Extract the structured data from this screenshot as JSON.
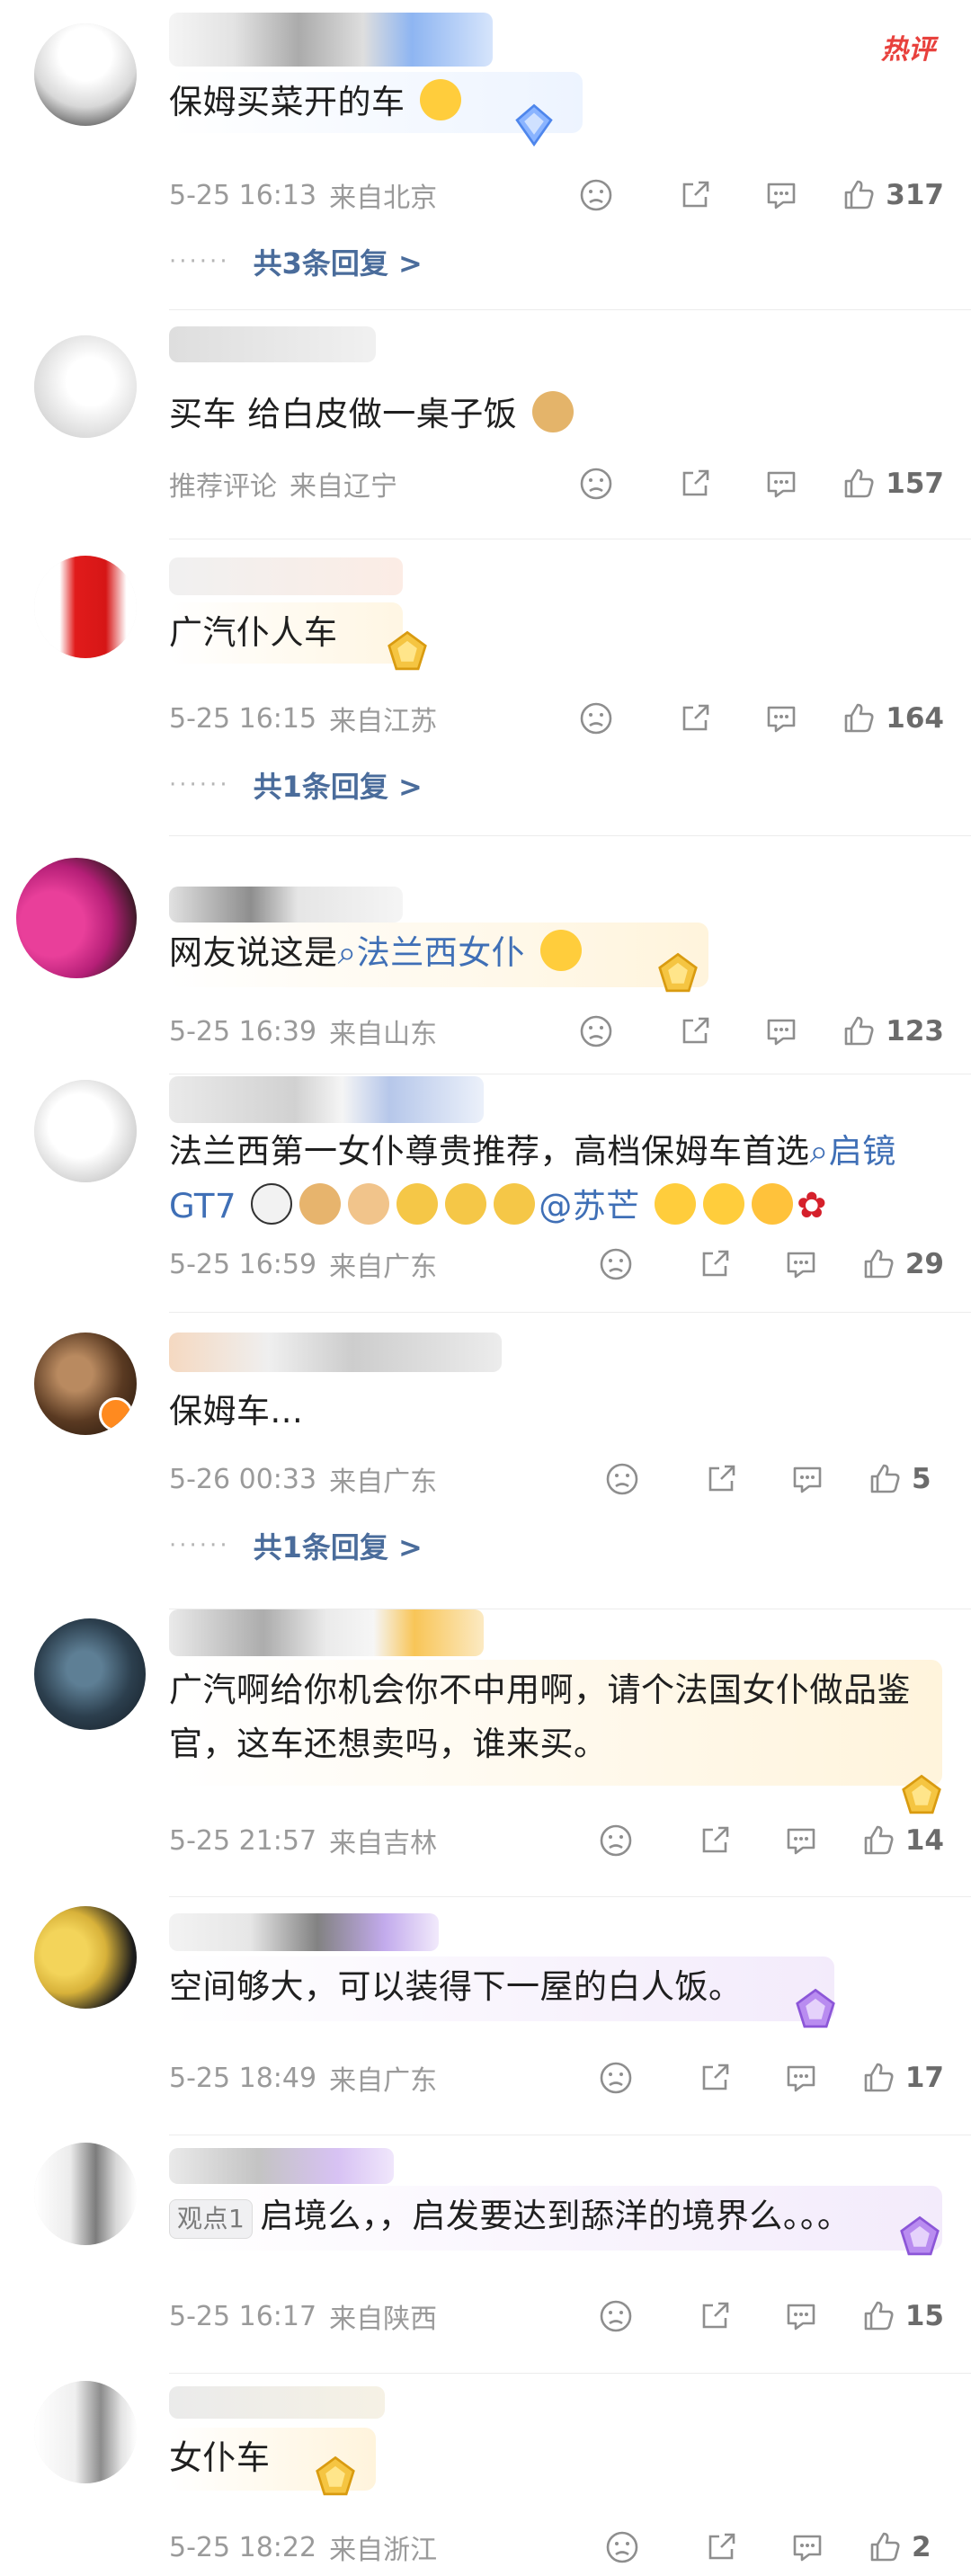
{
  "hot_label": "热评",
  "colors": {
    "link": "#3f6fb6",
    "meta": "#9a9a9a",
    "accent": "#e8413d"
  },
  "comments": [
    {
      "text": "保姆买菜开的车",
      "time": "5-25 16:13",
      "location": "来自北京",
      "likes": "317",
      "replies": "共3条回复 >"
    },
    {
      "text": "买车 给白皮做一桌子饭",
      "time": "推荐评论",
      "location": "来自辽宁",
      "likes": "157"
    },
    {
      "text": "广汽仆人车",
      "time": "5-25 16:15",
      "location": "来自江苏",
      "likes": "164",
      "replies": "共1条回复 >"
    },
    {
      "text_prefix": "网友说这是",
      "text_link": "法兰西女仆",
      "time": "5-25 16:39",
      "location": "来自山东",
      "likes": "123"
    },
    {
      "text": "法兰西第一女仆尊贵推荐，高档保姆车首选",
      "text_link": "启镜 GT7",
      "mention": "@苏芒",
      "time": "5-25 16:59",
      "location": "来自广东",
      "likes": "29"
    },
    {
      "text": "保姆车...",
      "time": "5-26 00:33",
      "location": "来自广东",
      "likes": "5",
      "replies": "共1条回复 >"
    },
    {
      "text": "广汽啊给你机会你不中用啊，请个法国女仆做品鉴官，这车还想卖吗，谁来买。",
      "time": "5-25 21:57",
      "location": "来自吉林",
      "likes": "14"
    },
    {
      "text": "空间够大，可以装得下一屋的白人饭。",
      "time": "5-25 18:49",
      "location": "来自广东",
      "likes": "17"
    },
    {
      "tag": "观点1",
      "text": "启境么，，启发要达到舔洋的境界么。。。",
      "time": "5-25 16:17",
      "location": "来自陕西",
      "likes": "15"
    },
    {
      "text": "女仆车",
      "time": "5-25 18:22",
      "location": "来自浙江",
      "likes": "2"
    }
  ]
}
